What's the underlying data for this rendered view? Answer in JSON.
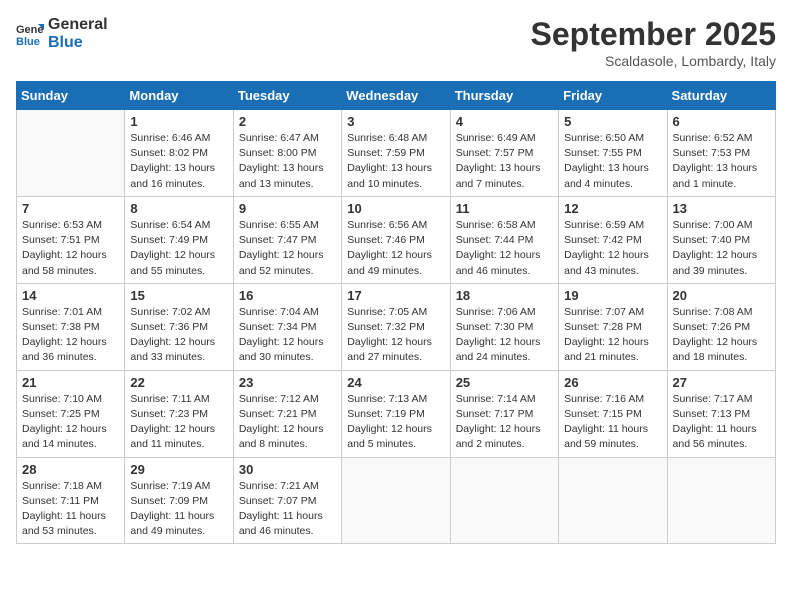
{
  "header": {
    "logo_line1": "General",
    "logo_line2": "Blue",
    "month": "September 2025",
    "location": "Scaldasole, Lombardy, Italy"
  },
  "weekdays": [
    "Sunday",
    "Monday",
    "Tuesday",
    "Wednesday",
    "Thursday",
    "Friday",
    "Saturday"
  ],
  "weeks": [
    [
      {
        "day": "",
        "info": ""
      },
      {
        "day": "1",
        "info": "Sunrise: 6:46 AM\nSunset: 8:02 PM\nDaylight: 13 hours\nand 16 minutes."
      },
      {
        "day": "2",
        "info": "Sunrise: 6:47 AM\nSunset: 8:00 PM\nDaylight: 13 hours\nand 13 minutes."
      },
      {
        "day": "3",
        "info": "Sunrise: 6:48 AM\nSunset: 7:59 PM\nDaylight: 13 hours\nand 10 minutes."
      },
      {
        "day": "4",
        "info": "Sunrise: 6:49 AM\nSunset: 7:57 PM\nDaylight: 13 hours\nand 7 minutes."
      },
      {
        "day": "5",
        "info": "Sunrise: 6:50 AM\nSunset: 7:55 PM\nDaylight: 13 hours\nand 4 minutes."
      },
      {
        "day": "6",
        "info": "Sunrise: 6:52 AM\nSunset: 7:53 PM\nDaylight: 13 hours\nand 1 minute."
      }
    ],
    [
      {
        "day": "7",
        "info": "Sunrise: 6:53 AM\nSunset: 7:51 PM\nDaylight: 12 hours\nand 58 minutes."
      },
      {
        "day": "8",
        "info": "Sunrise: 6:54 AM\nSunset: 7:49 PM\nDaylight: 12 hours\nand 55 minutes."
      },
      {
        "day": "9",
        "info": "Sunrise: 6:55 AM\nSunset: 7:47 PM\nDaylight: 12 hours\nand 52 minutes."
      },
      {
        "day": "10",
        "info": "Sunrise: 6:56 AM\nSunset: 7:46 PM\nDaylight: 12 hours\nand 49 minutes."
      },
      {
        "day": "11",
        "info": "Sunrise: 6:58 AM\nSunset: 7:44 PM\nDaylight: 12 hours\nand 46 minutes."
      },
      {
        "day": "12",
        "info": "Sunrise: 6:59 AM\nSunset: 7:42 PM\nDaylight: 12 hours\nand 43 minutes."
      },
      {
        "day": "13",
        "info": "Sunrise: 7:00 AM\nSunset: 7:40 PM\nDaylight: 12 hours\nand 39 minutes."
      }
    ],
    [
      {
        "day": "14",
        "info": "Sunrise: 7:01 AM\nSunset: 7:38 PM\nDaylight: 12 hours\nand 36 minutes."
      },
      {
        "day": "15",
        "info": "Sunrise: 7:02 AM\nSunset: 7:36 PM\nDaylight: 12 hours\nand 33 minutes."
      },
      {
        "day": "16",
        "info": "Sunrise: 7:04 AM\nSunset: 7:34 PM\nDaylight: 12 hours\nand 30 minutes."
      },
      {
        "day": "17",
        "info": "Sunrise: 7:05 AM\nSunset: 7:32 PM\nDaylight: 12 hours\nand 27 minutes."
      },
      {
        "day": "18",
        "info": "Sunrise: 7:06 AM\nSunset: 7:30 PM\nDaylight: 12 hours\nand 24 minutes."
      },
      {
        "day": "19",
        "info": "Sunrise: 7:07 AM\nSunset: 7:28 PM\nDaylight: 12 hours\nand 21 minutes."
      },
      {
        "day": "20",
        "info": "Sunrise: 7:08 AM\nSunset: 7:26 PM\nDaylight: 12 hours\nand 18 minutes."
      }
    ],
    [
      {
        "day": "21",
        "info": "Sunrise: 7:10 AM\nSunset: 7:25 PM\nDaylight: 12 hours\nand 14 minutes."
      },
      {
        "day": "22",
        "info": "Sunrise: 7:11 AM\nSunset: 7:23 PM\nDaylight: 12 hours\nand 11 minutes."
      },
      {
        "day": "23",
        "info": "Sunrise: 7:12 AM\nSunset: 7:21 PM\nDaylight: 12 hours\nand 8 minutes."
      },
      {
        "day": "24",
        "info": "Sunrise: 7:13 AM\nSunset: 7:19 PM\nDaylight: 12 hours\nand 5 minutes."
      },
      {
        "day": "25",
        "info": "Sunrise: 7:14 AM\nSunset: 7:17 PM\nDaylight: 12 hours\nand 2 minutes."
      },
      {
        "day": "26",
        "info": "Sunrise: 7:16 AM\nSunset: 7:15 PM\nDaylight: 11 hours\nand 59 minutes."
      },
      {
        "day": "27",
        "info": "Sunrise: 7:17 AM\nSunset: 7:13 PM\nDaylight: 11 hours\nand 56 minutes."
      }
    ],
    [
      {
        "day": "28",
        "info": "Sunrise: 7:18 AM\nSunset: 7:11 PM\nDaylight: 11 hours\nand 53 minutes."
      },
      {
        "day": "29",
        "info": "Sunrise: 7:19 AM\nSunset: 7:09 PM\nDaylight: 11 hours\nand 49 minutes."
      },
      {
        "day": "30",
        "info": "Sunrise: 7:21 AM\nSunset: 7:07 PM\nDaylight: 11 hours\nand 46 minutes."
      },
      {
        "day": "",
        "info": ""
      },
      {
        "day": "",
        "info": ""
      },
      {
        "day": "",
        "info": ""
      },
      {
        "day": "",
        "info": ""
      }
    ]
  ]
}
